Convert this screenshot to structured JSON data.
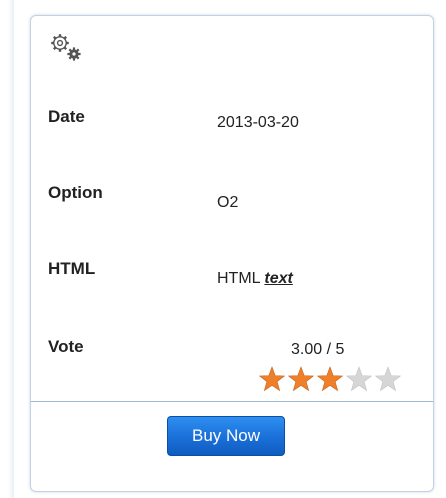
{
  "icons": {
    "settings": "gears-icon"
  },
  "fields": {
    "date": {
      "label": "Date",
      "value": "2013-03-20"
    },
    "option": {
      "label": "Option",
      "value": "O2"
    },
    "html": {
      "label": "HTML",
      "value_plain": "HTML ",
      "value_emphasis": "text"
    },
    "vote": {
      "label": "Vote",
      "score_text": "3.00 / 5",
      "rating": 3,
      "max": 5
    }
  },
  "colors": {
    "star_filled": "#f07f2a",
    "star_empty": "#d6d6d6",
    "button": "#1a6fd8",
    "card_border": "#c2d2e3"
  },
  "actions": {
    "buy_label": "Buy Now"
  }
}
